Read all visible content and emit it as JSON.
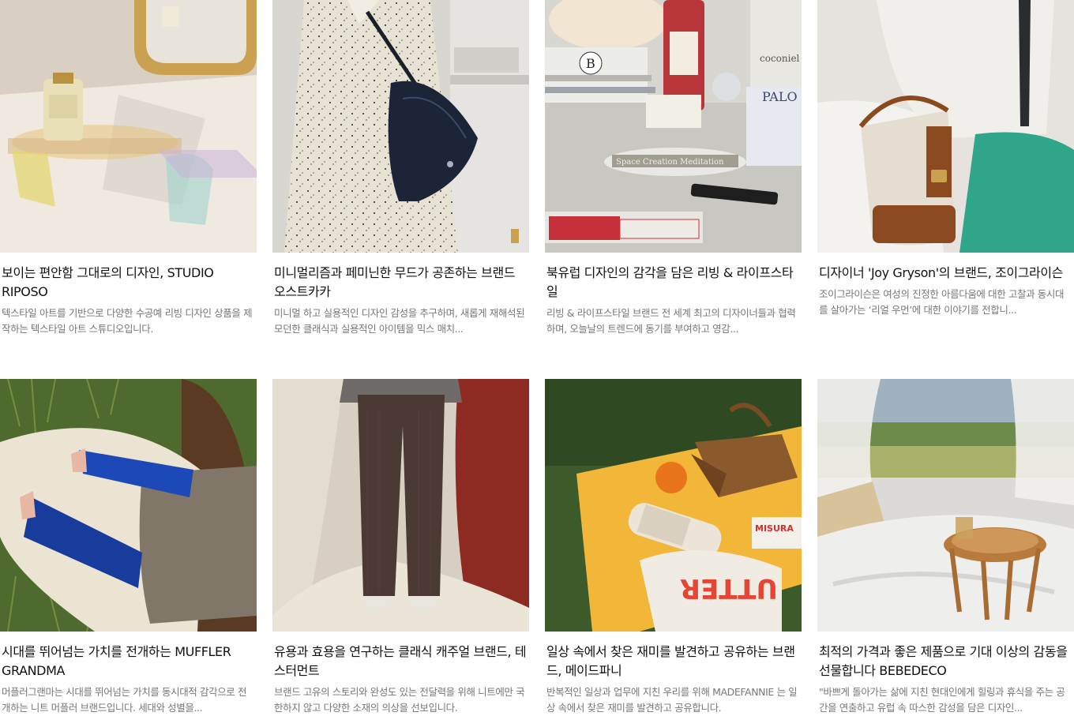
{
  "cards": [
    {
      "title": "보이는 편안함 그대로의 디자인, STUDIO RIPOSO",
      "description": "텍스타일 아트를 기반으로 다양한 수공예 리빙 디자인 상품을 제작하는 텍스타일 아트 스튜디오입니다.",
      "image": "acrylic-tray-perfume-mirror-image"
    },
    {
      "title": "미니멀리즘과 페미닌한 무드가 공존하는 브랜드 오스트카카",
      "description": "미니멀 하고 실용적인 디자인 감성을 추구하며, 새롭게 재해석된 모던한 클래식과 실용적인 아이템을 믹스 매치...",
      "image": "speckled-dress-leather-bag-image"
    },
    {
      "title": "북유럽 디자인의 감각을 담은 리빙 & 라이프스타일",
      "description": "리빙 & 라이프스타일 브랜드 전 세계 최고의 디자이너들과 협력하며, 오늘날의 트렌드에 동기를 부여하고 영감...",
      "image": "desk-wine-incense-image",
      "image_text": {
        "tag_letter": "B",
        "tray_text": "Space Creation Meditation",
        "book_text": "coconiel room",
        "box_text": "PALO"
      }
    },
    {
      "title": "디자이너 'Joy Gryson'의 브랜드, 조이그라이슨",
      "description": "조이그라이슨은 여성의 진정한 아름다움에 대한 고찰과 동시대를 살아가는 ‘리얼 우먼’에 대한 이야기를 전합니...",
      "image": "canvas-bucket-bag-image"
    },
    {
      "title": "시대를 뛰어넘는 가치를 전개하는 MUFFLER GRANDMA",
      "description": "머플러그랜마는 시대를 뛰어넘는 가치를 동시대적 감각으로 전개하는 니트 머플러 브랜드입니다. 세대와 성별을...",
      "image": "blue-knit-armwarmers-grass-image"
    },
    {
      "title": "유용과 효용을 연구하는 클래식 캐주얼 브랜드, 테스터먼트",
      "description": "브랜드 고유의 스토리와 완성도 있는 전달력을 위해 니트에만 국한하지 않고 다양한 소재의 의상을 선보입니다.",
      "image": "check-trousers-studio-image"
    },
    {
      "title": "일상 속에서 찾은 재미를 발견하고 공유하는 브랜드, 메이드파니",
      "description": "반복적인 일상과 업무에 지친 우리를 위해 MADEFANNIE 는 일상 속에서 찾은 재미를 발견하고 공유합니다.",
      "image": "picnic-basket-blanket-image",
      "image_text": {
        "shirt_text": "UTTER",
        "box_text": "MISURA"
      }
    },
    {
      "title": "최적의 가격과 좋은 제품으로 기대 이상의 감동을 선물합니다 BEBEDECO",
      "description": "\"바쁘게 돌아가는 삶에 지친 현대인에게 힐링과 휴식을 주는 공간을 연출하고 유럽 속 따스한 감성을 담은 디자인...",
      "image": "rattan-tray-bedding-window-image"
    }
  ],
  "colors": {
    "title": "#111111",
    "description": "#777777",
    "background": "#ffffff"
  }
}
